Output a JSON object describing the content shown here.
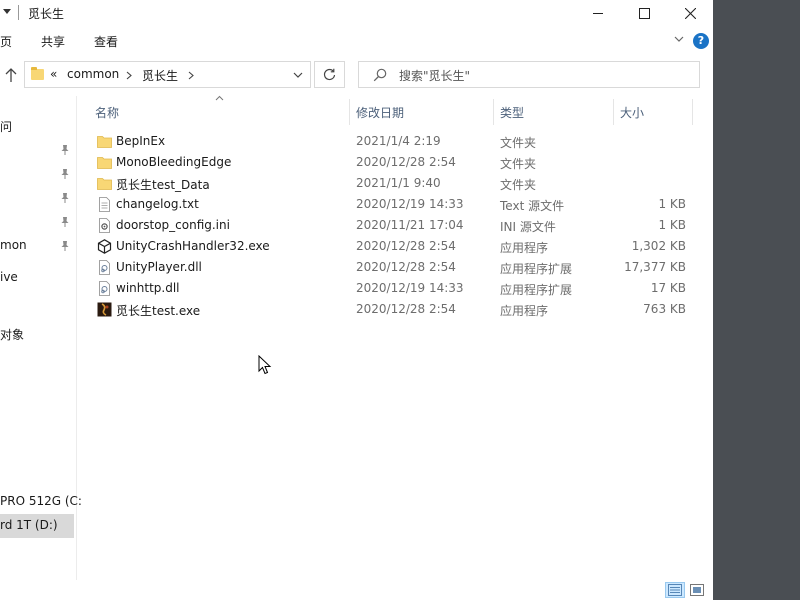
{
  "window": {
    "title": "觅长生",
    "minimize_label": "Minimize",
    "maximize_label": "Maximize",
    "close_label": "Close"
  },
  "ribbon": {
    "tabs": [
      "页",
      "共享",
      "查看"
    ]
  },
  "address": {
    "overflow": "«",
    "crumbs": [
      "common",
      "觅长生"
    ]
  },
  "search": {
    "placeholder": "搜索\"觅长生\""
  },
  "nav": {
    "items": [
      {
        "label": "问",
        "pinned": false
      },
      {
        "label": "",
        "pinned": true
      },
      {
        "label": "",
        "pinned": true
      },
      {
        "label": "",
        "pinned": true
      },
      {
        "label": "",
        "pinned": true
      },
      {
        "label": "mon",
        "pinned": true
      },
      {
        "label": "ive",
        "pinned": false
      },
      {
        "label": "对象",
        "pinned": false
      },
      {
        "label": "PRO 512G (C:",
        "pinned": false
      },
      {
        "label": "rd 1T (D:)",
        "pinned": false,
        "selected": true
      }
    ]
  },
  "columns": {
    "name": "名称",
    "date": "修改日期",
    "type": "类型",
    "size": "大小"
  },
  "files": [
    {
      "name": "BepInEx",
      "date": "2021/1/4 2:19",
      "type": "文件夹",
      "size": "",
      "icon": "folder-icon"
    },
    {
      "name": "MonoBleedingEdge",
      "date": "2020/12/28 2:54",
      "type": "文件夹",
      "size": "",
      "icon": "folder-icon"
    },
    {
      "name": "觅长生test_Data",
      "date": "2021/1/1 9:40",
      "type": "文件夹",
      "size": "",
      "icon": "folder-icon"
    },
    {
      "name": "changelog.txt",
      "date": "2020/12/19 14:33",
      "type": "Text 源文件",
      "size": "1 KB",
      "icon": "text-file-icon"
    },
    {
      "name": "doorstop_config.ini",
      "date": "2020/11/21 17:04",
      "type": "INI 源文件",
      "size": "1 KB",
      "icon": "config-file-icon"
    },
    {
      "name": "UnityCrashHandler32.exe",
      "date": "2020/12/28 2:54",
      "type": "应用程序",
      "size": "1,302 KB",
      "icon": "unity-icon"
    },
    {
      "name": "UnityPlayer.dll",
      "date": "2020/12/28 2:54",
      "type": "应用程序扩展",
      "size": "17,377 KB",
      "icon": "dll-file-icon"
    },
    {
      "name": "winhttp.dll",
      "date": "2020/12/19 14:33",
      "type": "应用程序扩展",
      "size": "17 KB",
      "icon": "dll-file-icon"
    },
    {
      "name": "觅长生test.exe",
      "date": "2020/12/28 2:54",
      "type": "应用程序",
      "size": "763 KB",
      "icon": "game-exe-icon"
    }
  ],
  "colors": {
    "folder": "#f8d775",
    "selection": "#d9d9d9",
    "header_text": "#4c607a",
    "help_blue": "#1a73c6"
  }
}
